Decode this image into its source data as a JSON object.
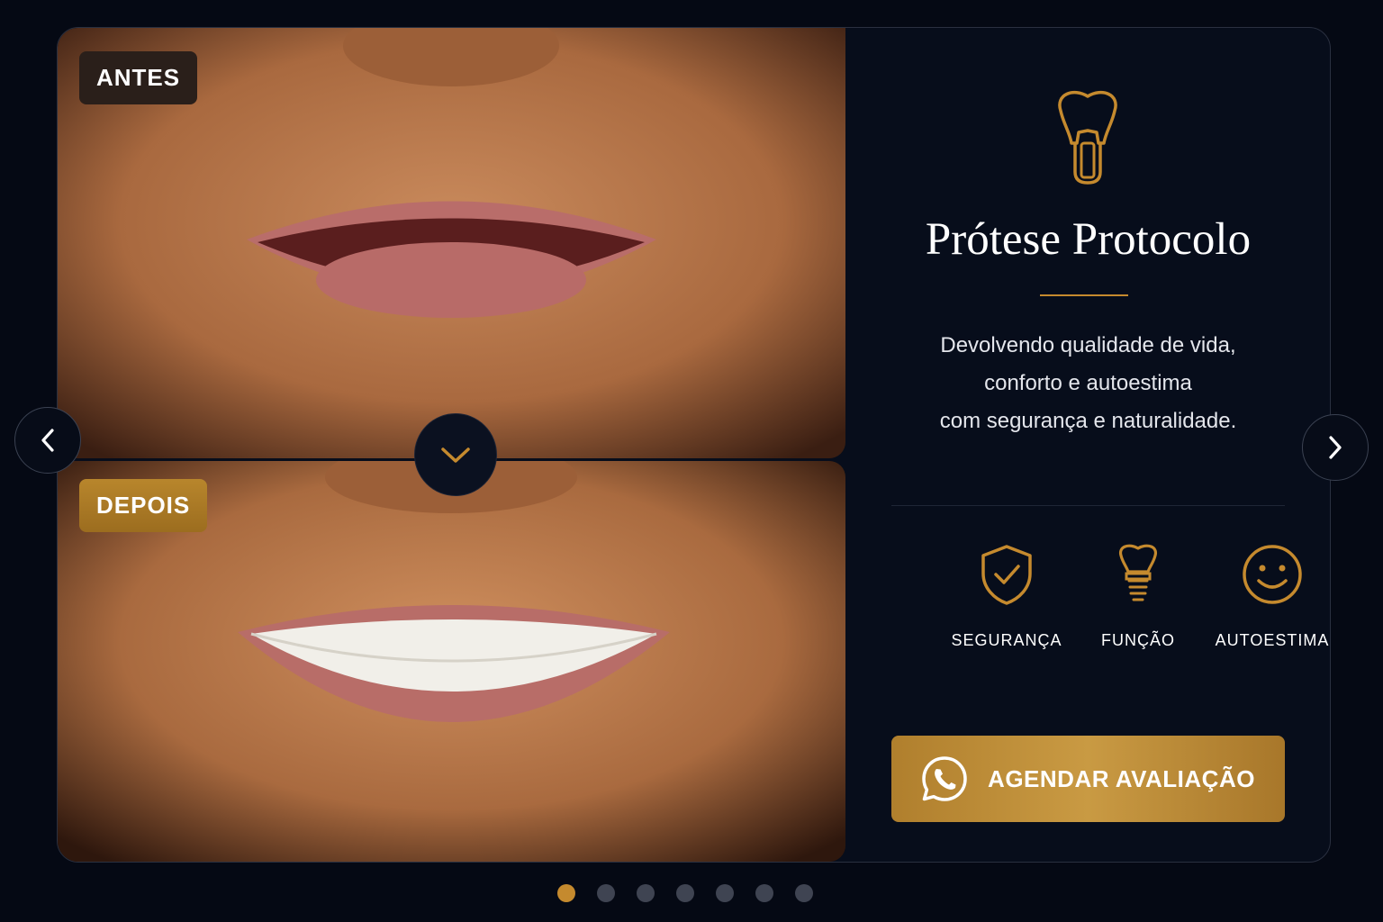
{
  "gallery": {
    "before_label": "ANTES",
    "after_label": "DEPOIS",
    "divider_icon": "chevron-down-icon"
  },
  "navigation": {
    "prev_icon": "chevron-left-icon",
    "next_icon": "chevron-right-icon"
  },
  "panel": {
    "icon": "tooth-implant-icon",
    "title": "Prótese Protocolo",
    "description_lines": [
      "Devolvendo qualidade de vida,",
      "conforto e autoestima",
      "com segurança e naturalidade."
    ],
    "features": [
      {
        "icon": "shield-check-icon",
        "label": "SEGURANÇA"
      },
      {
        "icon": "implant-icon",
        "label": "FUNÇÃO"
      },
      {
        "icon": "smiley-icon",
        "label": "AUTOESTIMA"
      }
    ],
    "cta": {
      "icon": "whatsapp-icon",
      "label": "AGENDAR AVALIAÇÃO"
    }
  },
  "pagination": {
    "total": 7,
    "active_index": 0
  },
  "colors": {
    "accent": "#c58a2e",
    "background": "#050914",
    "card": "#070d1b"
  }
}
